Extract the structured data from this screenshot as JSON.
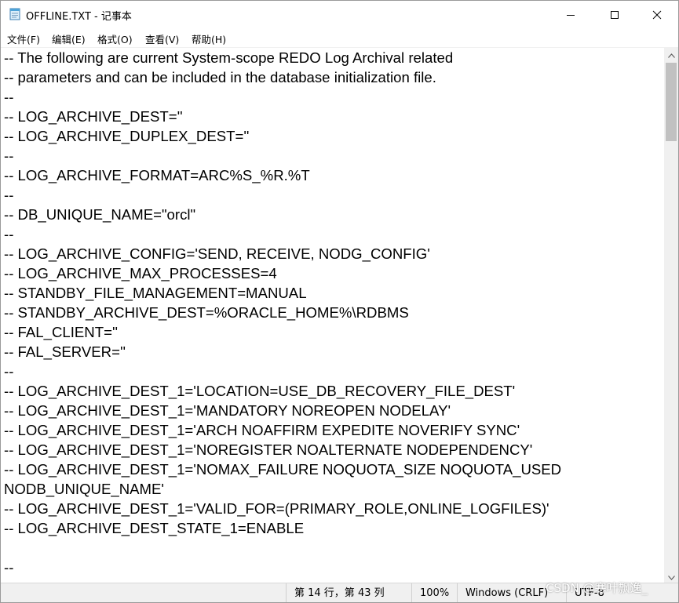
{
  "window": {
    "title": "OFFLINE.TXT - 记事本",
    "controls": {
      "minimize": "minimize",
      "maximize": "maximize",
      "close": "close"
    }
  },
  "menu": [
    {
      "label": "文件(F)"
    },
    {
      "label": "编辑(E)"
    },
    {
      "label": "格式(O)"
    },
    {
      "label": "查看(V)"
    },
    {
      "label": "帮助(H)"
    }
  ],
  "editor": {
    "lines": [
      "-- The following are current System-scope REDO Log Archival related",
      "-- parameters and can be included in the database initialization file.",
      "--",
      "-- LOG_ARCHIVE_DEST=''",
      "-- LOG_ARCHIVE_DUPLEX_DEST=''",
      "--",
      "-- LOG_ARCHIVE_FORMAT=ARC%S_%R.%T",
      "--",
      "-- DB_UNIQUE_NAME=\"orcl\"",
      "--",
      "-- LOG_ARCHIVE_CONFIG='SEND, RECEIVE, NODG_CONFIG'",
      "-- LOG_ARCHIVE_MAX_PROCESSES=4",
      "-- STANDBY_FILE_MANAGEMENT=MANUAL",
      "-- STANDBY_ARCHIVE_DEST=%ORACLE_HOME%\\RDBMS",
      "-- FAL_CLIENT=''",
      "-- FAL_SERVER=''",
      "--",
      "-- LOG_ARCHIVE_DEST_1='LOCATION=USE_DB_RECOVERY_FILE_DEST'",
      "-- LOG_ARCHIVE_DEST_1='MANDATORY NOREOPEN NODELAY'",
      "-- LOG_ARCHIVE_DEST_1='ARCH NOAFFIRM EXPEDITE NOVERIFY SYNC'",
      "-- LOG_ARCHIVE_DEST_1='NOREGISTER NOALTERNATE NODEPENDENCY'",
      "-- LOG_ARCHIVE_DEST_1='NOMAX_FAILURE NOQUOTA_SIZE NOQUOTA_USED",
      "NODB_UNIQUE_NAME'",
      "-- LOG_ARCHIVE_DEST_1='VALID_FOR=(PRIMARY_ROLE,ONLINE_LOGFILES)'",
      "-- LOG_ARCHIVE_DEST_STATE_1=ENABLE",
      "",
      "--"
    ]
  },
  "status": {
    "position": "第 14 行，第 43 列",
    "zoom": "100%",
    "line_ending": "Windows (CRLF)",
    "encoding": "UTF-8"
  },
  "watermark": "CSDN @寒叶飘逸_",
  "colors": {
    "window_bg": "#ffffff",
    "statusbar_bg": "#f0f0f0",
    "scrollbar_track": "#f0f0f0",
    "scrollbar_thumb": "#c1c1c1",
    "text": "#000000"
  },
  "icons": {
    "app": "notepad-icon",
    "minimize": "minimize-icon",
    "maximize": "maximize-icon",
    "close": "close-icon",
    "scroll_up": "chevron-up-icon",
    "scroll_down": "chevron-down-icon"
  }
}
